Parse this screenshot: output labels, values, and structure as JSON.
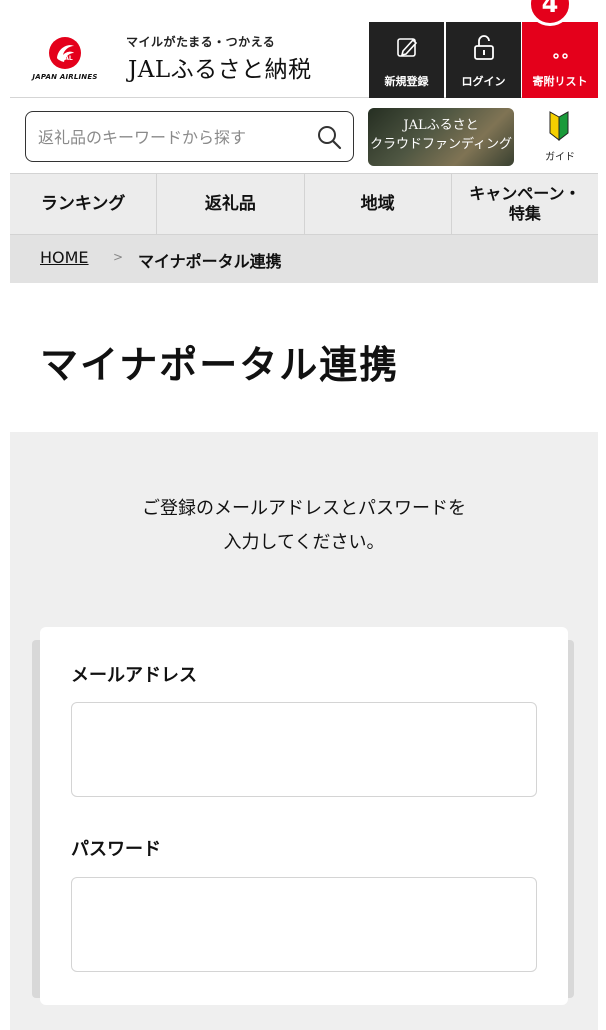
{
  "header": {
    "logo_text": "JAPAN AIRLINES",
    "brand_sub": "マイルがたまる・つかえる",
    "brand_main": "JALふるさと納税",
    "register_label": "新規登録",
    "login_label": "ログイン",
    "wishlist_label": "寄附リスト",
    "wishlist_count": "4",
    "accent_color": "#e4001b"
  },
  "search": {
    "placeholder": "返礼品のキーワードから探す",
    "value": ""
  },
  "crowdfunding": {
    "line1": "JALふるさと",
    "line2": "クラウドファンディング"
  },
  "guide": {
    "label": "ガイド"
  },
  "nav": {
    "items": [
      {
        "label": "ランキング"
      },
      {
        "label": "返礼品"
      },
      {
        "label": "地域"
      },
      {
        "label": "キャンペーン・\n特集"
      }
    ]
  },
  "breadcrumb": {
    "home": "HOME",
    "separator": ">",
    "current": "マイナポータル連携"
  },
  "page": {
    "title": "マイナポータル連携",
    "intro_line1": "ご登録のメールアドレスとパスワードを",
    "intro_line2": "入力してください。"
  },
  "form": {
    "email_label": "メールアドレス",
    "email_value": "",
    "password_label": "パスワード",
    "password_value": ""
  }
}
